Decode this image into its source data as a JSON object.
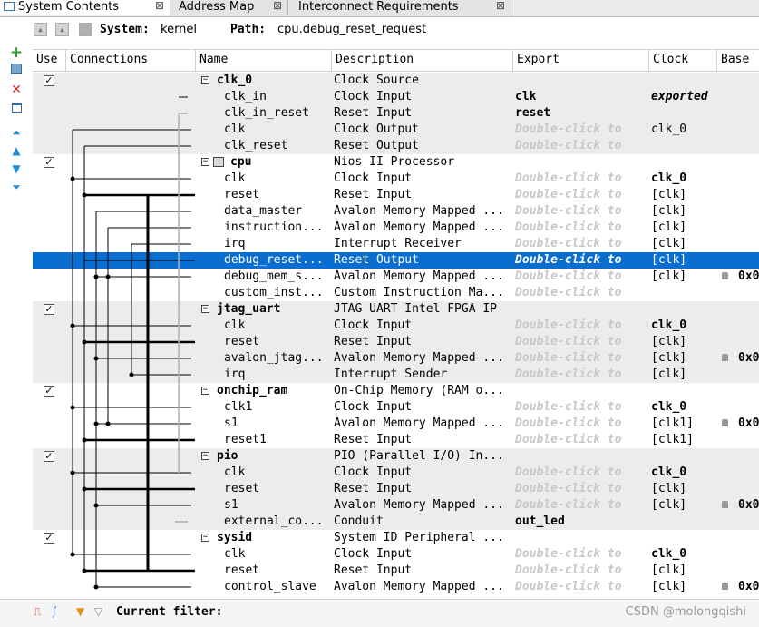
{
  "tabs": [
    {
      "label": "System Contents",
      "close": "⊠"
    },
    {
      "label": "Address Map",
      "close": "⊠"
    },
    {
      "label": "Interconnect Requirements",
      "close": "⊠"
    }
  ],
  "toolbar": {
    "system_label": "System:",
    "system_value": "kernel",
    "path_label": "Path:",
    "path_value": "cpu.debug_reset_request"
  },
  "columns": {
    "use": "Use",
    "connections": "Connections",
    "name": "Name",
    "description": "Description",
    "export": "Export",
    "clock": "Clock",
    "base": "Base"
  },
  "rows": [
    {
      "kind": "module",
      "name": "clk_0",
      "description": "Clock Source",
      "export": "",
      "clock": "",
      "base": "",
      "checked": true
    },
    {
      "kind": "iface",
      "name": "clk_in",
      "description": "Clock Input",
      "export": "clk",
      "clock": "exported",
      "clock_style": "exp",
      "base": ""
    },
    {
      "kind": "iface",
      "name": "clk_in_reset",
      "description": "Reset Input",
      "export": "reset",
      "clock": "",
      "base": ""
    },
    {
      "kind": "iface",
      "name": "clk",
      "description": "Clock Output",
      "export": "Double-click to",
      "clock": "clk_0",
      "base": ""
    },
    {
      "kind": "iface",
      "name": "clk_reset",
      "description": "Reset Output",
      "export": "Double-click to",
      "clock": "",
      "base": ""
    },
    {
      "kind": "module",
      "name": "cpu",
      "description": "Nios II Processor",
      "export": "",
      "clock": "",
      "base": "",
      "checked": true
    },
    {
      "kind": "iface",
      "name": "clk",
      "description": "Clock Input",
      "export": "Double-click to",
      "clock": "clk_0",
      "clock_style": "bold",
      "base": ""
    },
    {
      "kind": "iface",
      "name": "reset",
      "description": "Reset Input",
      "export": "Double-click to",
      "clock": "[clk]",
      "base": ""
    },
    {
      "kind": "iface",
      "name": "data_master",
      "description": "Avalon Memory Mapped ...",
      "export": "Double-click to",
      "clock": "[clk]",
      "base": ""
    },
    {
      "kind": "iface",
      "name": "instruction...",
      "description": "Avalon Memory Mapped ...",
      "export": "Double-click to",
      "clock": "[clk]",
      "base": ""
    },
    {
      "kind": "iface",
      "name": "irq",
      "description": "Interrupt Receiver",
      "export": "Double-click to",
      "clock": "[clk]",
      "base": ""
    },
    {
      "kind": "iface",
      "name": "debug_reset...",
      "description": "Reset Output",
      "export": "Double-click to",
      "clock": "[clk]",
      "base": "",
      "selected": true
    },
    {
      "kind": "iface",
      "name": "debug_mem_s...",
      "description": "Avalon Memory Mapped ...",
      "export": "Double-click to",
      "clock": "[clk]",
      "base": "0x0"
    },
    {
      "kind": "iface",
      "name": "custom_inst...",
      "description": "Custom Instruction Ma...",
      "export": "Double-click to",
      "clock": "",
      "base": ""
    },
    {
      "kind": "module",
      "name": "jtag_uart",
      "description": "JTAG UART Intel FPGA IP",
      "export": "",
      "clock": "",
      "base": "",
      "checked": true
    },
    {
      "kind": "iface",
      "name": "clk",
      "description": "Clock Input",
      "export": "Double-click to",
      "clock": "clk_0",
      "clock_style": "bold",
      "base": ""
    },
    {
      "kind": "iface",
      "name": "reset",
      "description": "Reset Input",
      "export": "Double-click to",
      "clock": "[clk]",
      "base": ""
    },
    {
      "kind": "iface",
      "name": "avalon_jtag...",
      "description": "Avalon Memory Mapped ...",
      "export": "Double-click to",
      "clock": "[clk]",
      "base": "0x0"
    },
    {
      "kind": "iface",
      "name": "irq",
      "description": "Interrupt Sender",
      "export": "Double-click to",
      "clock": "[clk]",
      "base": ""
    },
    {
      "kind": "module",
      "name": "onchip_ram",
      "description": "On-Chip Memory (RAM o...",
      "export": "",
      "clock": "",
      "base": "",
      "checked": true
    },
    {
      "kind": "iface",
      "name": "clk1",
      "description": "Clock Input",
      "export": "Double-click to",
      "clock": "clk_0",
      "clock_style": "bold",
      "base": ""
    },
    {
      "kind": "iface",
      "name": "s1",
      "description": "Avalon Memory Mapped ...",
      "export": "Double-click to",
      "clock": "[clk1]",
      "base": "0x0"
    },
    {
      "kind": "iface",
      "name": "reset1",
      "description": "Reset Input",
      "export": "Double-click to",
      "clock": "[clk1]",
      "base": ""
    },
    {
      "kind": "module",
      "name": "pio",
      "description": "PIO (Parallel I/O) In...",
      "export": "",
      "clock": "",
      "base": "",
      "checked": true
    },
    {
      "kind": "iface",
      "name": "clk",
      "description": "Clock Input",
      "export": "Double-click to",
      "clock": "clk_0",
      "clock_style": "bold",
      "base": ""
    },
    {
      "kind": "iface",
      "name": "reset",
      "description": "Reset Input",
      "export": "Double-click to",
      "clock": "[clk]",
      "base": ""
    },
    {
      "kind": "iface",
      "name": "s1",
      "description": "Avalon Memory Mapped ...",
      "export": "Double-click to",
      "clock": "[clk]",
      "base": "0x0"
    },
    {
      "kind": "iface",
      "name": "external_co...",
      "description": "Conduit",
      "export": "out_led",
      "clock": "",
      "base": ""
    },
    {
      "kind": "module",
      "name": "sysid",
      "description": "System ID Peripheral ...",
      "export": "",
      "clock": "",
      "base": "",
      "checked": true
    },
    {
      "kind": "iface",
      "name": "clk",
      "description": "Clock Input",
      "export": "Double-click to",
      "clock": "clk_0",
      "clock_style": "bold",
      "base": ""
    },
    {
      "kind": "iface",
      "name": "reset",
      "description": "Reset Input",
      "export": "Double-click to",
      "clock": "[clk]",
      "base": ""
    },
    {
      "kind": "iface",
      "name": "control_slave",
      "description": "Avalon Memory Mapped ...",
      "export": "Double-click to",
      "clock": "[clk]",
      "base": "0x0"
    }
  ],
  "footer": {
    "filter_label": "Current filter:"
  },
  "watermark": "CSDN @molongqishi",
  "colors": {
    "selection": "#0a6ed1",
    "add_icon": "#2e9e2e",
    "remove_icon": "#d83030",
    "move_icons": "#1e8fd6"
  }
}
